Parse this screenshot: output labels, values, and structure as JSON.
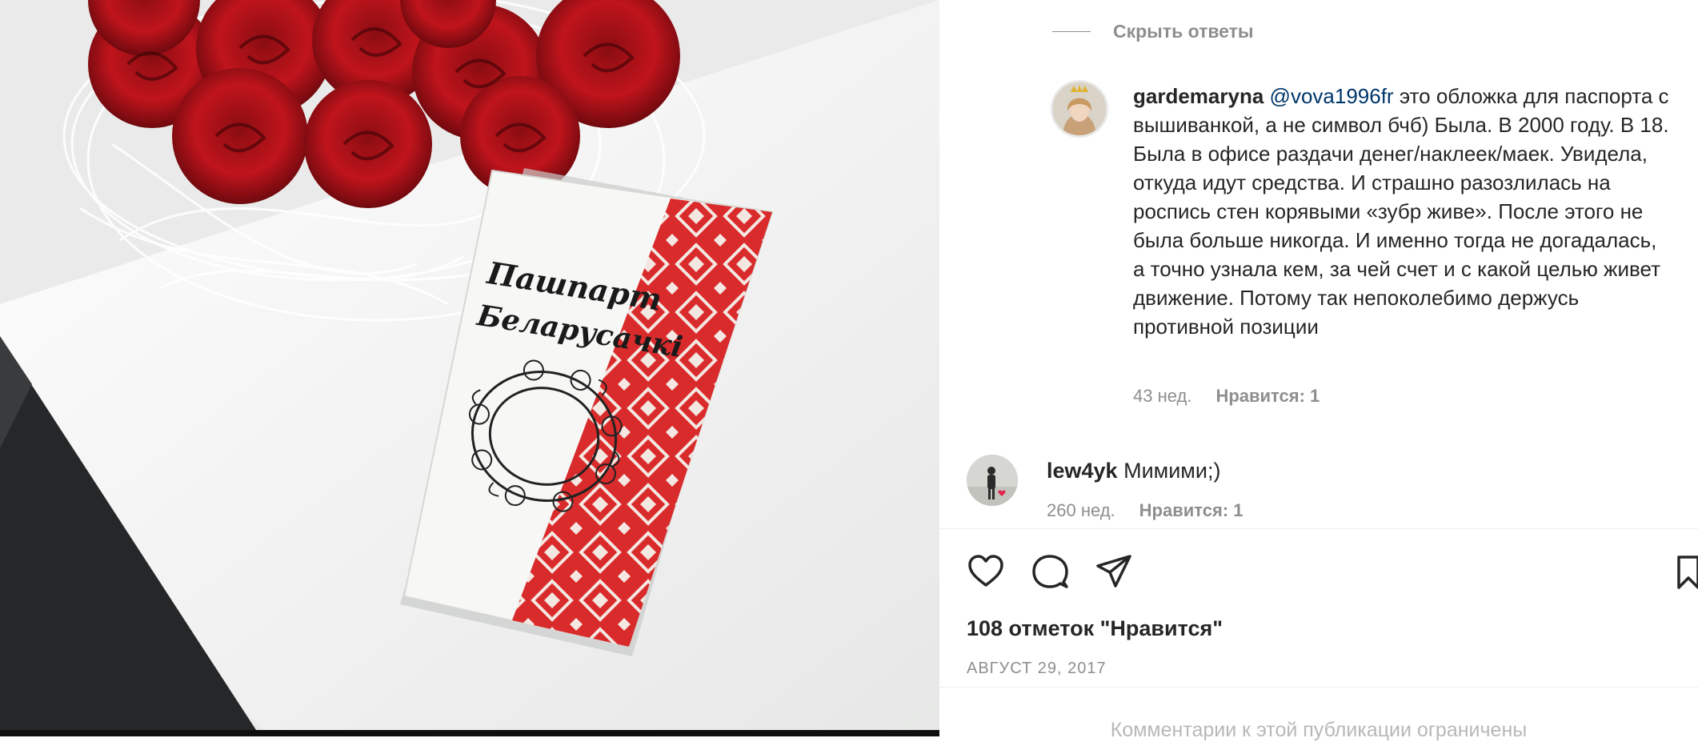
{
  "photo": {
    "cover_title_line1": "Пашпарт",
    "cover_title_line2": "Беларусачкі"
  },
  "thread": {
    "hide_replies_label": "Скрыть ответы",
    "reply": {
      "username": "gardemaryna",
      "mention": "@vova1996fr",
      "text": " это обложка для паспорта с вышиванкой, а не символ бчб) Была. В 2000 году. В 18. Была в офисе раздачи денег/наклеек/маек. Увидела, откуда идут средства. И страшно разозлилась на роспись стен корявыми «зубр живе». После этого не была больше никогда. И именно тогда не догадалась, а точно узнала кем, за чей счет и с какой целью живет движение. Потому так непоколебимо держусь противной позиции",
      "age": "43 нед.",
      "likes": "Нравится: 1"
    },
    "comment": {
      "username": "lew4yk",
      "text": " Мимими;)",
      "age": "260 нед.",
      "likes": "Нравится: 1"
    }
  },
  "actions": {
    "icons": [
      "heart-icon",
      "comment-bubble-icon",
      "paper-plane-icon",
      "bookmark-icon"
    ]
  },
  "post": {
    "likes_count": "108 отметок \"Нравится\"",
    "date": "август 29, 2017",
    "comments_limited": "Комментарии к этой публикации ограничены"
  },
  "colors": {
    "mention": "#00376b",
    "muted": "#8e8e8e",
    "text": "#262626",
    "embroidery_red": "#d92b2b"
  }
}
